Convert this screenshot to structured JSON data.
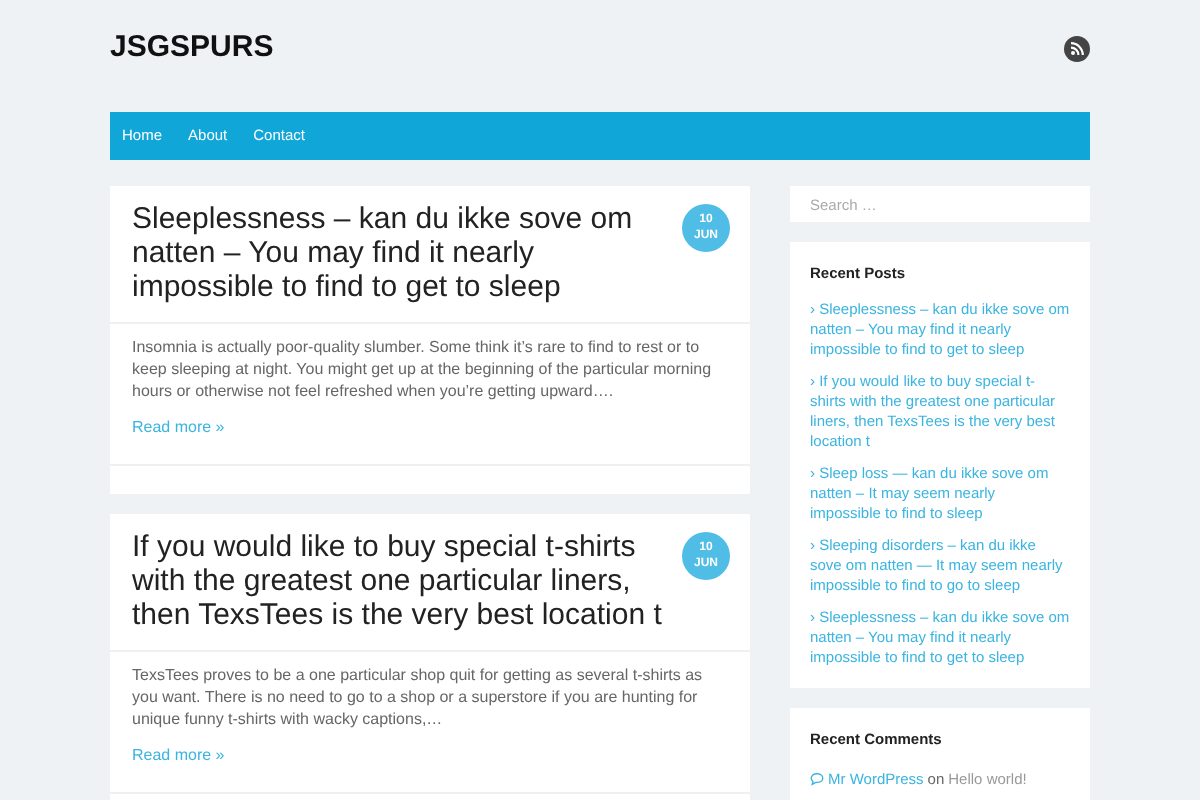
{
  "site_title": "JSGSPURS",
  "nav": [
    {
      "label": "Home"
    },
    {
      "label": "About"
    },
    {
      "label": "Contact"
    }
  ],
  "posts": [
    {
      "title": "Sleeplessness – kan du ikke sove om natten – You may find it nearly impossible to find to get to sleep",
      "day": "10",
      "month": "JUN",
      "excerpt": "Insomnia is actually poor-quality slumber. Some think it’s rare to find to rest or to keep sleeping at night. You might get up at the beginning of the particular morning hours or otherwise not feel refreshed when you’re getting upward….",
      "read_more": "Read more »"
    },
    {
      "title": "If you would like to buy special t-shirts with the greatest one particular liners, then TexsTees is the very best location t",
      "day": "10",
      "month": "JUN",
      "excerpt": "TexsTees proves to be a one particular shop quit for getting as several t-shirts as you want. There is no need to go to a shop or a superstore if you are hunting for unique funny t-shirts with wacky captions,…",
      "read_more": "Read more »"
    }
  ],
  "search": {
    "placeholder": "Search …"
  },
  "recent_posts": {
    "title": "Recent Posts",
    "bullet": "›",
    "items": [
      "Sleeplessness – kan du ikke sove om natten – You may find it nearly impossible to find to get to sleep",
      "If you would like to buy special t-shirts with the greatest one particular liners, then TexsTees is the very best location t",
      "Sleep loss — kan du ikke sove om natten – It may seem nearly impossible to find to sleep",
      "Sleeping disorders – kan du ikke sove om natten — It may seem nearly impossible to find to go to sleep",
      "Sleeplessness – kan du ikke sove om natten – You may find it nearly impossible to find to get to sleep"
    ]
  },
  "recent_comments": {
    "title": "Recent Comments",
    "items": [
      {
        "author": "Mr WordPress",
        "on": "on",
        "post": "Hello world!"
      }
    ]
  }
}
